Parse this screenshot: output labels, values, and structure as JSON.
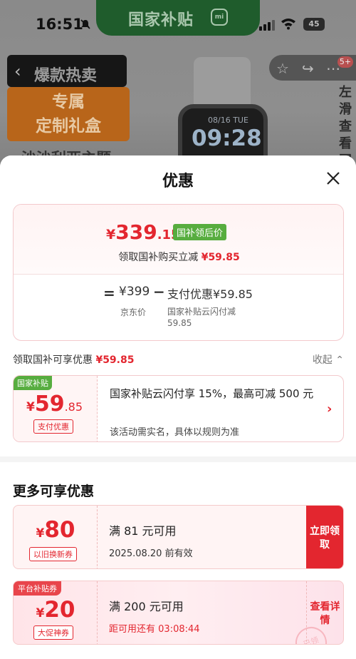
{
  "status_bar": {
    "time": "16:51",
    "island_text": "国家补贴",
    "island_logo": "mi",
    "battery": "45"
  },
  "background": {
    "back_title": "爆款热卖",
    "gift_banner_line1": "专属",
    "gift_banner_line2": "定制礼盒",
    "gift_sub": "沙沙利亚主题",
    "badge": "5+",
    "watch_date": "08/16 TUE",
    "watch_time": "09:28",
    "side_hint": "左滑查看国补"
  },
  "sheet": {
    "title": "优惠",
    "price_card": {
      "currency": "¥",
      "price_int": "339",
      "price_dec": ".15",
      "price_tag": "国补领后价",
      "immediate_text": "领取国补购买立减",
      "immediate_amount": "¥59.85",
      "eq": "=",
      "jd_price": "¥399",
      "minus": "−",
      "pay_discount": "支付优惠¥59.85",
      "jd_label": "京东价",
      "pay_note": "国家补贴云闪付减59.85"
    },
    "gov_section": {
      "label": "领取国补可享优惠",
      "amount": "¥59.85",
      "collapse": "收起"
    },
    "gov_card": {
      "corner": "国家补贴",
      "currency": "¥",
      "price_int": "59",
      "price_dec": ".85",
      "tag": "支付优惠",
      "title": "国家补贴云闪付享 15%，最高可减 500 元",
      "desc": "该活动需实名，具体以规则为准"
    },
    "more_title": "更多可享优惠",
    "coupons": [
      {
        "currency": "¥",
        "amount": "80",
        "tag": "以旧换新券",
        "condition": "满 81 元可用",
        "date_prefix": "",
        "date": "2025.08.20 前有效",
        "button": "立即领取"
      },
      {
        "corner": "平台补贴券",
        "currency": "¥",
        "amount": "20",
        "tag": "大促神券",
        "condition": "满 200 元可用",
        "date_prefix": "距可用还有",
        "date": "03:08:44",
        "button": "查看详情",
        "stamp": "已领"
      }
    ]
  },
  "colors": {
    "accent_red": "#e3262f",
    "gov_green": "#57ad3f"
  }
}
